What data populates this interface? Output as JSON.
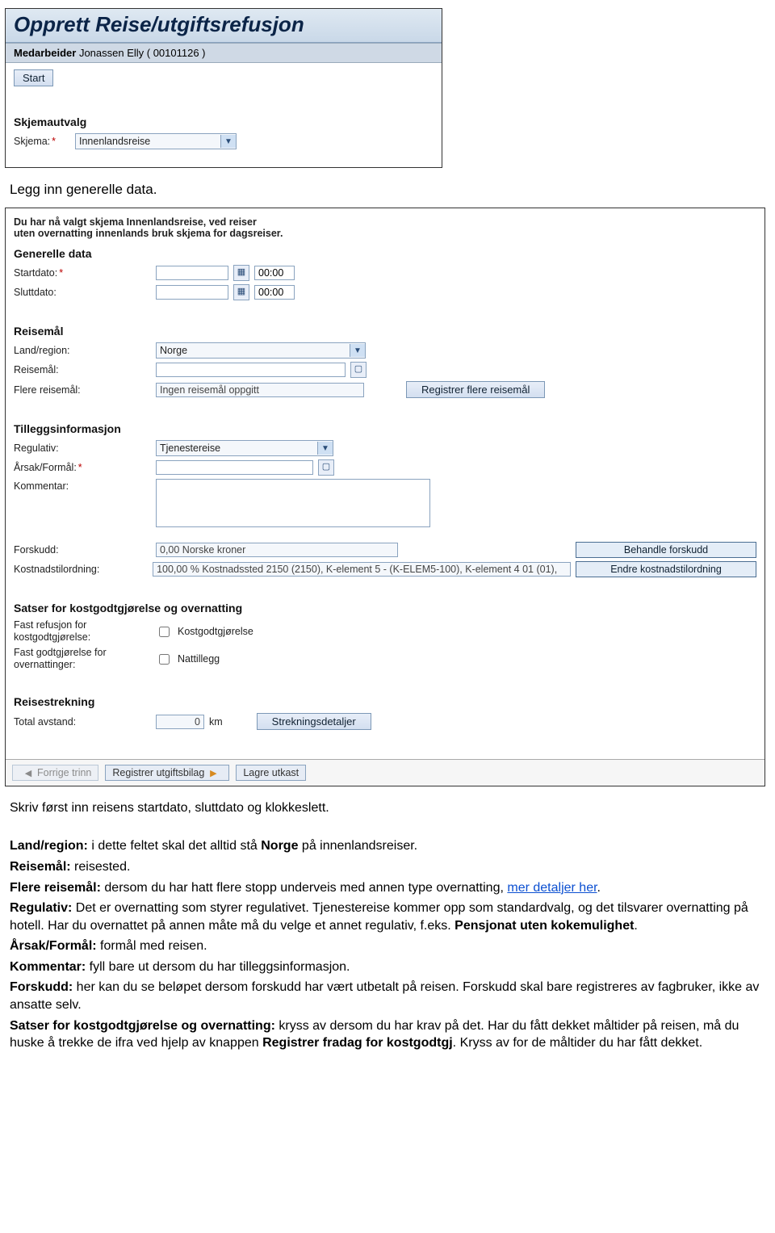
{
  "panel1": {
    "title": "Opprett Reise/utgiftsrefusjon",
    "employee_label": "Medarbeider",
    "employee_value": "Jonassen Elly ( 00101126 )",
    "start_button": "Start",
    "skjemautvalg_title": "Skjemautvalg",
    "skjema_label": "Skjema:",
    "skjema_value": "Innenlandsreise"
  },
  "intro_line": "Legg inn generelle data.",
  "panel2": {
    "info_line1": "Du har nå valgt skjema Innenlandsreise, ved reiser",
    "info_line2": "uten overnatting innenlands bruk skjema for dagsreiser.",
    "section_general": "Generelle data",
    "startdato_label": "Startdato:",
    "startdato_value": "",
    "starttid_value": "00:00",
    "sluttdato_label": "Sluttdato:",
    "sluttdato_value": "",
    "slutttid_value": "00:00",
    "section_reisemal": "Reisemål",
    "landregion_label": "Land/region:",
    "landregion_value": "Norge",
    "reisemal_label": "Reisemål:",
    "reisemal_value": "",
    "flere_label": "Flere reisemål:",
    "flere_value": "Ingen reisemål oppgitt",
    "reg_flere_btn": "Registrer flere reisemål",
    "section_tillegg": "Tilleggsinformasjon",
    "regulativ_label": "Regulativ:",
    "regulativ_value": "Tjenestereise",
    "aarsak_label": "Årsak/Formål:",
    "aarsak_value": "",
    "kommentar_label": "Kommentar:",
    "kommentar_value": "",
    "forskudd_label": "Forskudd:",
    "forskudd_value": "0,00 Norske kroner",
    "beh_forskudd_btn": "Behandle forskudd",
    "kostnadsord_label": "Kostnadstilordning:",
    "kostnadsord_value": "100,00 % Kostnadssted 2150 (2150), K-element 5 - (K-ELEM5-100), K-element 4 01 (01),",
    "endre_kost_btn": "Endre kostnadstilordning",
    "section_satser": "Satser for kostgodtgjørelse og overnatting",
    "fast_kost_label": "Fast refusjon for kostgodtgjørelse:",
    "fast_kost_cb": "Kostgodtgjørelse",
    "fast_natt_label": "Fast godtgjørelse for overnattinger:",
    "fast_natt_cb": "Nattillegg",
    "section_strekning": "Reisestrekning",
    "total_avstand_label": "Total avstand:",
    "total_avstand_value": "0",
    "km_label": "km",
    "strekning_btn": "Strekningsdetaljer",
    "forrige_btn": "Forrige trinn",
    "reg_utgifts_btn": "Registrer utgiftsbilag",
    "lagre_btn": "Lagre utkast"
  },
  "instr": {
    "p0": "Skriv først inn reisens startdato, sluttdato og klokkeslett.",
    "p1a": "Land/region:",
    "p1b": " i dette feltet skal det alltid stå ",
    "p1c": "Norge",
    "p1d": " på innenlandsreiser.",
    "p2a": "Reisemål:",
    "p2b": " reisested.",
    "p3a": "Flere reisemål:",
    "p3b": " dersom du har hatt flere stopp underveis med annen type overnatting, ",
    "p3link": "mer detaljer her",
    "p4a": "Regulativ:",
    "p4b": " Det er overnatting som styrer regulativet. Tjenestereise kommer opp som standardvalg, og det tilsvarer overnatting på hotell. Har du overnattet på annen måte må du velge et annet regulativ, f.eks. ",
    "p4c": "Pensjonat uten kokemulighet",
    "p4d": ".",
    "p5a": "Årsak/Formål:",
    "p5b": " formål med reisen.",
    "p6a": "Kommentar:",
    "p6b": " fyll bare ut dersom du har tilleggsinformasjon.",
    "p7a": "Forskudd:",
    "p7b": " her kan du se beløpet dersom forskudd har vært utbetalt på reisen. Forskudd skal bare registreres av fagbruker, ikke av ansatte selv.",
    "p8a": "Satser for kostgodtgjørelse og overnatting:",
    "p8b": " kryss av dersom du har krav på det. Har du fått dekket måltider på reisen, må du huske å trekke de ifra ved hjelp av knappen ",
    "p8c": "Registrer fradag for kostgodtgj",
    "p8d": ". Kryss av for de måltider du har fått dekket."
  }
}
